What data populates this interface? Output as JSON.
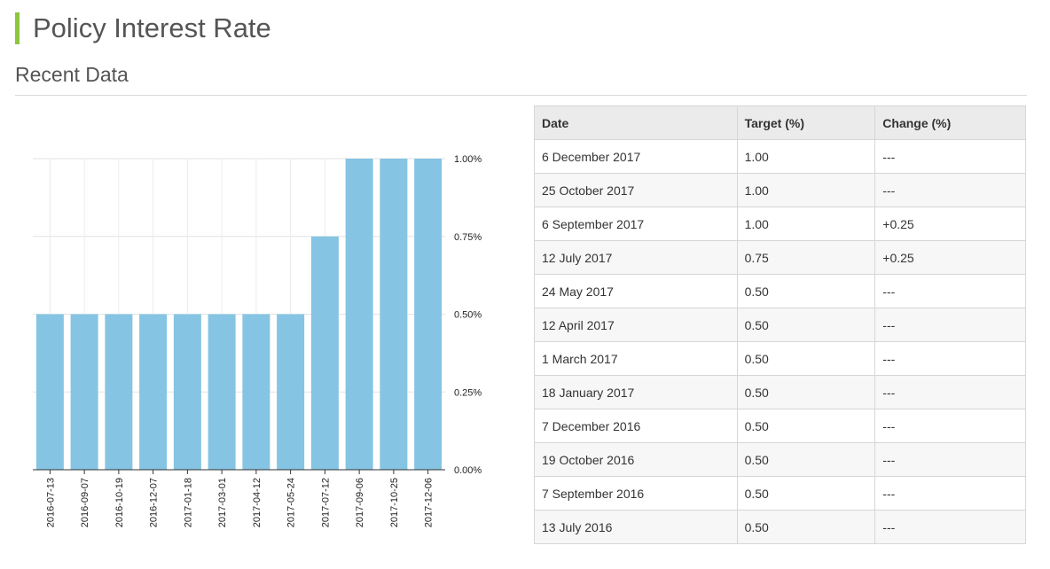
{
  "page": {
    "title": "Policy Interest Rate",
    "section_title": "Recent Data",
    "accent_color": "#8cc63f"
  },
  "chart_data": {
    "type": "bar",
    "categories": [
      "2016-07-13",
      "2016-09-07",
      "2016-10-19",
      "2016-12-07",
      "2017-01-18",
      "2017-03-01",
      "2017-04-12",
      "2017-05-24",
      "2017-07-12",
      "2017-09-06",
      "2017-10-25",
      "2017-12-06"
    ],
    "values": [
      0.5,
      0.5,
      0.5,
      0.5,
      0.5,
      0.5,
      0.5,
      0.5,
      0.75,
      1.0,
      1.0,
      1.0
    ],
    "y_ticks": [
      0,
      0.25,
      0.5,
      0.75,
      1.0
    ],
    "y_tick_labels": [
      "0.00%",
      "0.25%",
      "0.50%",
      "0.75%",
      "1.00%"
    ],
    "ylim": [
      0,
      1.0
    ],
    "y_axis_side": "right",
    "grid": true,
    "bar_color": "#86c4e3",
    "title": "",
    "xlabel": "",
    "ylabel": ""
  },
  "table": {
    "headers": {
      "date": "Date",
      "target": "Target (%)",
      "change": "Change (%)"
    },
    "rows": [
      {
        "date": "6 December 2017",
        "target": "1.00",
        "change": "---"
      },
      {
        "date": "25 October 2017",
        "target": "1.00",
        "change": "---"
      },
      {
        "date": "6 September 2017",
        "target": "1.00",
        "change": "+0.25"
      },
      {
        "date": "12 July 2017",
        "target": "0.75",
        "change": "+0.25"
      },
      {
        "date": "24 May 2017",
        "target": "0.50",
        "change": "---"
      },
      {
        "date": "12 April 2017",
        "target": "0.50",
        "change": "---"
      },
      {
        "date": "1 March 2017",
        "target": "0.50",
        "change": "---"
      },
      {
        "date": "18 January 2017",
        "target": "0.50",
        "change": "---"
      },
      {
        "date": "7 December 2016",
        "target": "0.50",
        "change": "---"
      },
      {
        "date": "19 October 2016",
        "target": "0.50",
        "change": "---"
      },
      {
        "date": "7 September 2016",
        "target": "0.50",
        "change": "---"
      },
      {
        "date": "13 July 2016",
        "target": "0.50",
        "change": "---"
      }
    ]
  }
}
